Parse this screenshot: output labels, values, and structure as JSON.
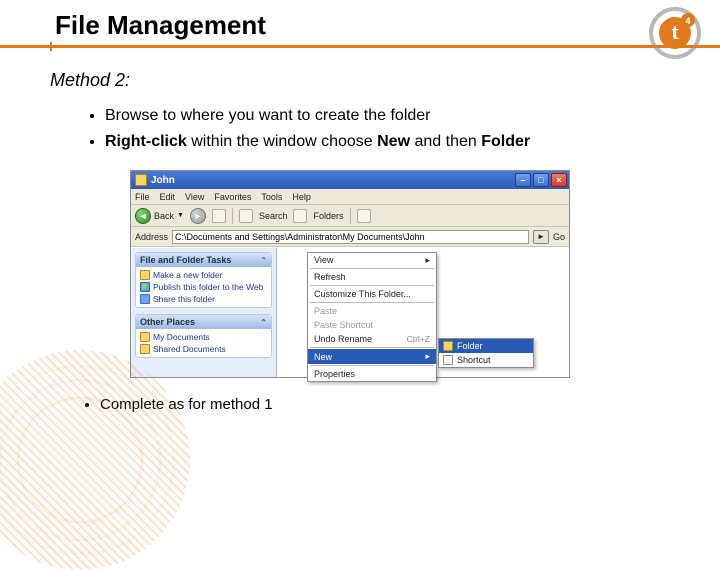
{
  "title": "File Management",
  "logo": {
    "badge": "4"
  },
  "subhead": "Method 2:",
  "bullets_top": [
    {
      "text": "Browse to where you want to create the folder"
    },
    {
      "html_parts": [
        "Right-click",
        " within the window choose ",
        "New",
        " and then ",
        "Folder"
      ]
    }
  ],
  "bullet_bottom": "Complete as for method 1",
  "fig": {
    "titlebar": {
      "title": "John"
    },
    "menubar": [
      "File",
      "Edit",
      "View",
      "Favorites",
      "Tools",
      "Help"
    ],
    "toolbar": {
      "back": "Back",
      "search": "Search",
      "folders": "Folders"
    },
    "addrbar": {
      "label": "Address",
      "value": "C:\\Documents and Settings\\Administrator\\My Documents\\John",
      "go": "Go"
    },
    "sidebar": {
      "panel1": {
        "head": "File and Folder Tasks",
        "items": [
          "Make a new folder",
          "Publish this folder to the Web",
          "Share this folder"
        ]
      },
      "panel2": {
        "head": "Other Places",
        "items": [
          "My Documents",
          "Shared Documents"
        ]
      }
    },
    "ctxmenu": {
      "view": "View",
      "refresh": "Refresh",
      "customize": "Customize This Folder...",
      "paste": "Paste",
      "paste_shortcut": "Paste Shortcut",
      "undo": "Undo Rename",
      "undo_kb": "Ctrl+Z",
      "new": "New",
      "properties": "Properties"
    },
    "submenu": {
      "folder": "Folder",
      "shortcut": "Shortcut"
    }
  }
}
